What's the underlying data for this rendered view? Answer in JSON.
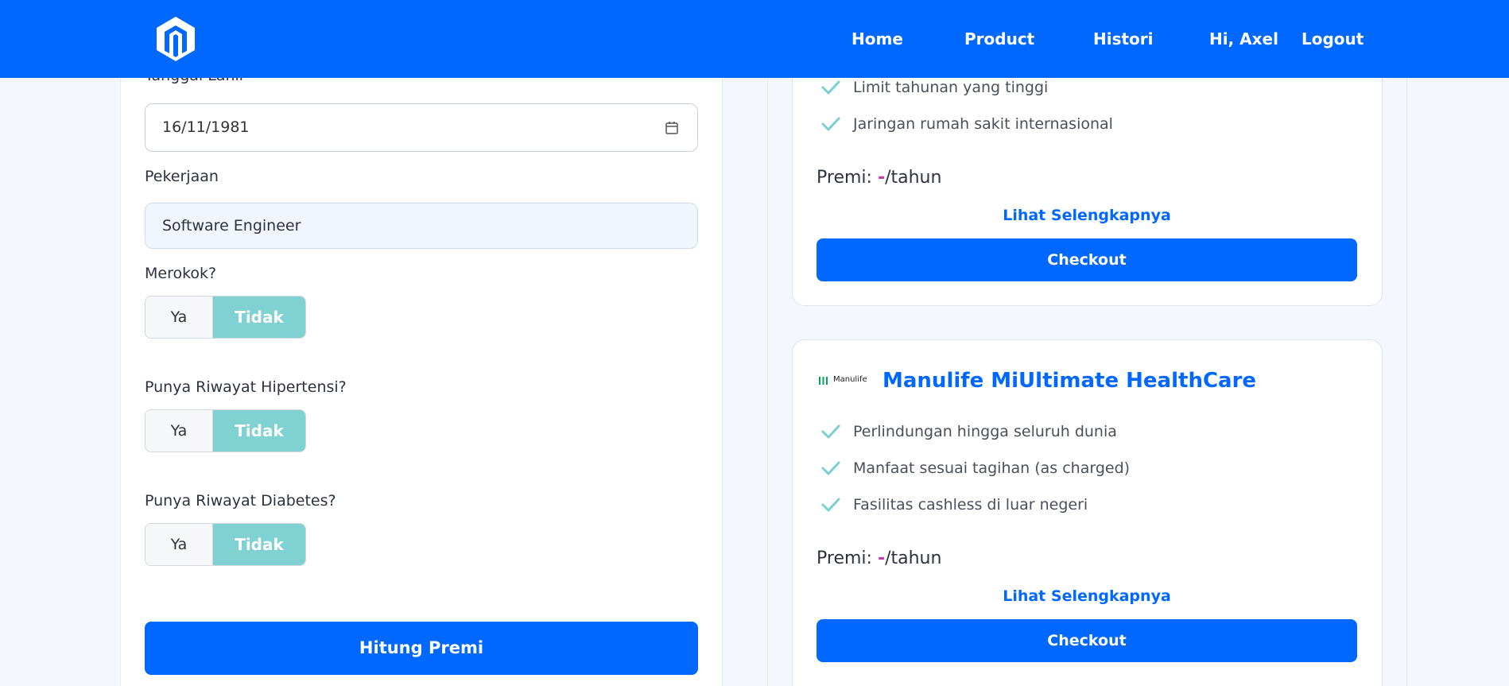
{
  "nav": {
    "links": [
      "Home",
      "Product",
      "Histori"
    ],
    "greeting": "Hi, Axel",
    "logout": "Logout"
  },
  "form": {
    "birthdate_label": "Tanggal Lahir",
    "birthdate_value": "16/11/1981",
    "job_label": "Pekerjaan",
    "job_value": "Software Engineer",
    "questions": [
      {
        "label": "Merokok?",
        "yes": "Ya",
        "no": "Tidak",
        "selected": "Tidak"
      },
      {
        "label": "Punya Riwayat Hipertensi?",
        "yes": "Ya",
        "no": "Tidak",
        "selected": "Tidak"
      },
      {
        "label": "Punya Riwayat Diabetes?",
        "yes": "Ya",
        "no": "Tidak",
        "selected": "Tidak"
      }
    ],
    "submit": "Hitung Premi"
  },
  "cards": [
    {
      "features": [
        "Limit tahunan yang tinggi",
        "Jaringan rumah sakit internasional"
      ],
      "premi_label": "Premi: ",
      "premi_value": "-",
      "premi_suffix": "/tahun",
      "more": "Lihat Selengkapnya",
      "checkout": "Checkout"
    },
    {
      "brand": "Manulife",
      "title": "Manulife MiUltimate HealthCare",
      "features": [
        "Perlindungan hingga seluruh dunia",
        "Manfaat sesuai tagihan (as charged)",
        "Fasilitas cashless di luar negeri"
      ],
      "premi_label": "Premi: ",
      "premi_value": "-",
      "premi_suffix": "/tahun",
      "more": "Lihat Selengkapnya",
      "checkout": "Checkout"
    }
  ],
  "colors": {
    "primary": "#0068ff",
    "toggle_selected": "#80d1d2",
    "check": "#7ccfcf",
    "premi_dash": "#c03bab"
  }
}
